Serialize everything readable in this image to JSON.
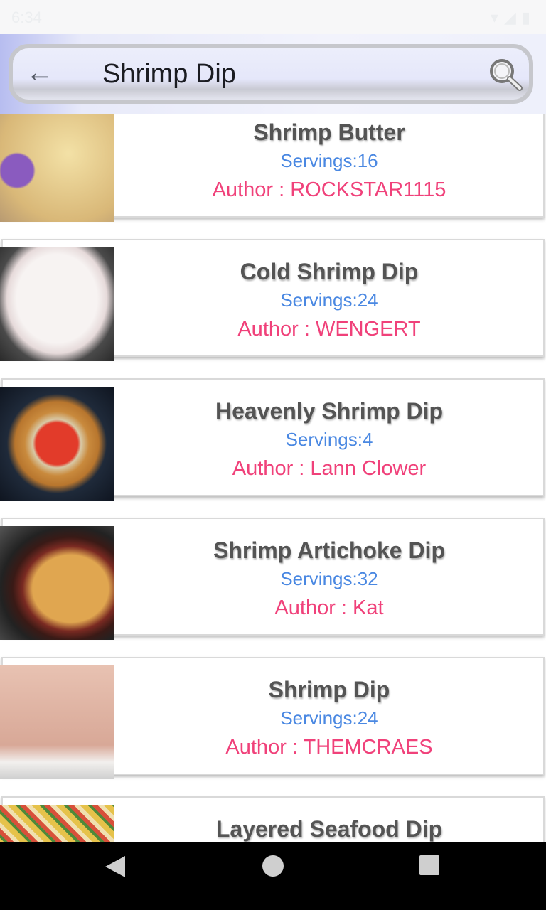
{
  "status_bar": {
    "time": "6:34"
  },
  "header": {
    "query": "Shrimp Dip",
    "back_icon": "arrow-left-icon",
    "search_icon": "magnifier-icon"
  },
  "recipes": [
    {
      "title": "Shrimp Butter",
      "servings": "Servings:16",
      "author": "Author : ROCKSTAR1115"
    },
    {
      "title": "Cold Shrimp Dip",
      "servings": "Servings:24",
      "author": "Author : WENGERT"
    },
    {
      "title": "Heavenly Shrimp Dip",
      "servings": "Servings:4",
      "author": "Author : Lann Clower"
    },
    {
      "title": "Shrimp Artichoke Dip",
      "servings": "Servings:32",
      "author": "Author : Kat"
    },
    {
      "title": "Shrimp Dip",
      "servings": "Servings:24",
      "author": "Author : THEMCRAES"
    },
    {
      "title": "Layered Seafood Dip",
      "servings": "",
      "author": ""
    }
  ],
  "colors": {
    "title": "#545454",
    "servings": "#4a88e2",
    "author": "#f0417a"
  }
}
